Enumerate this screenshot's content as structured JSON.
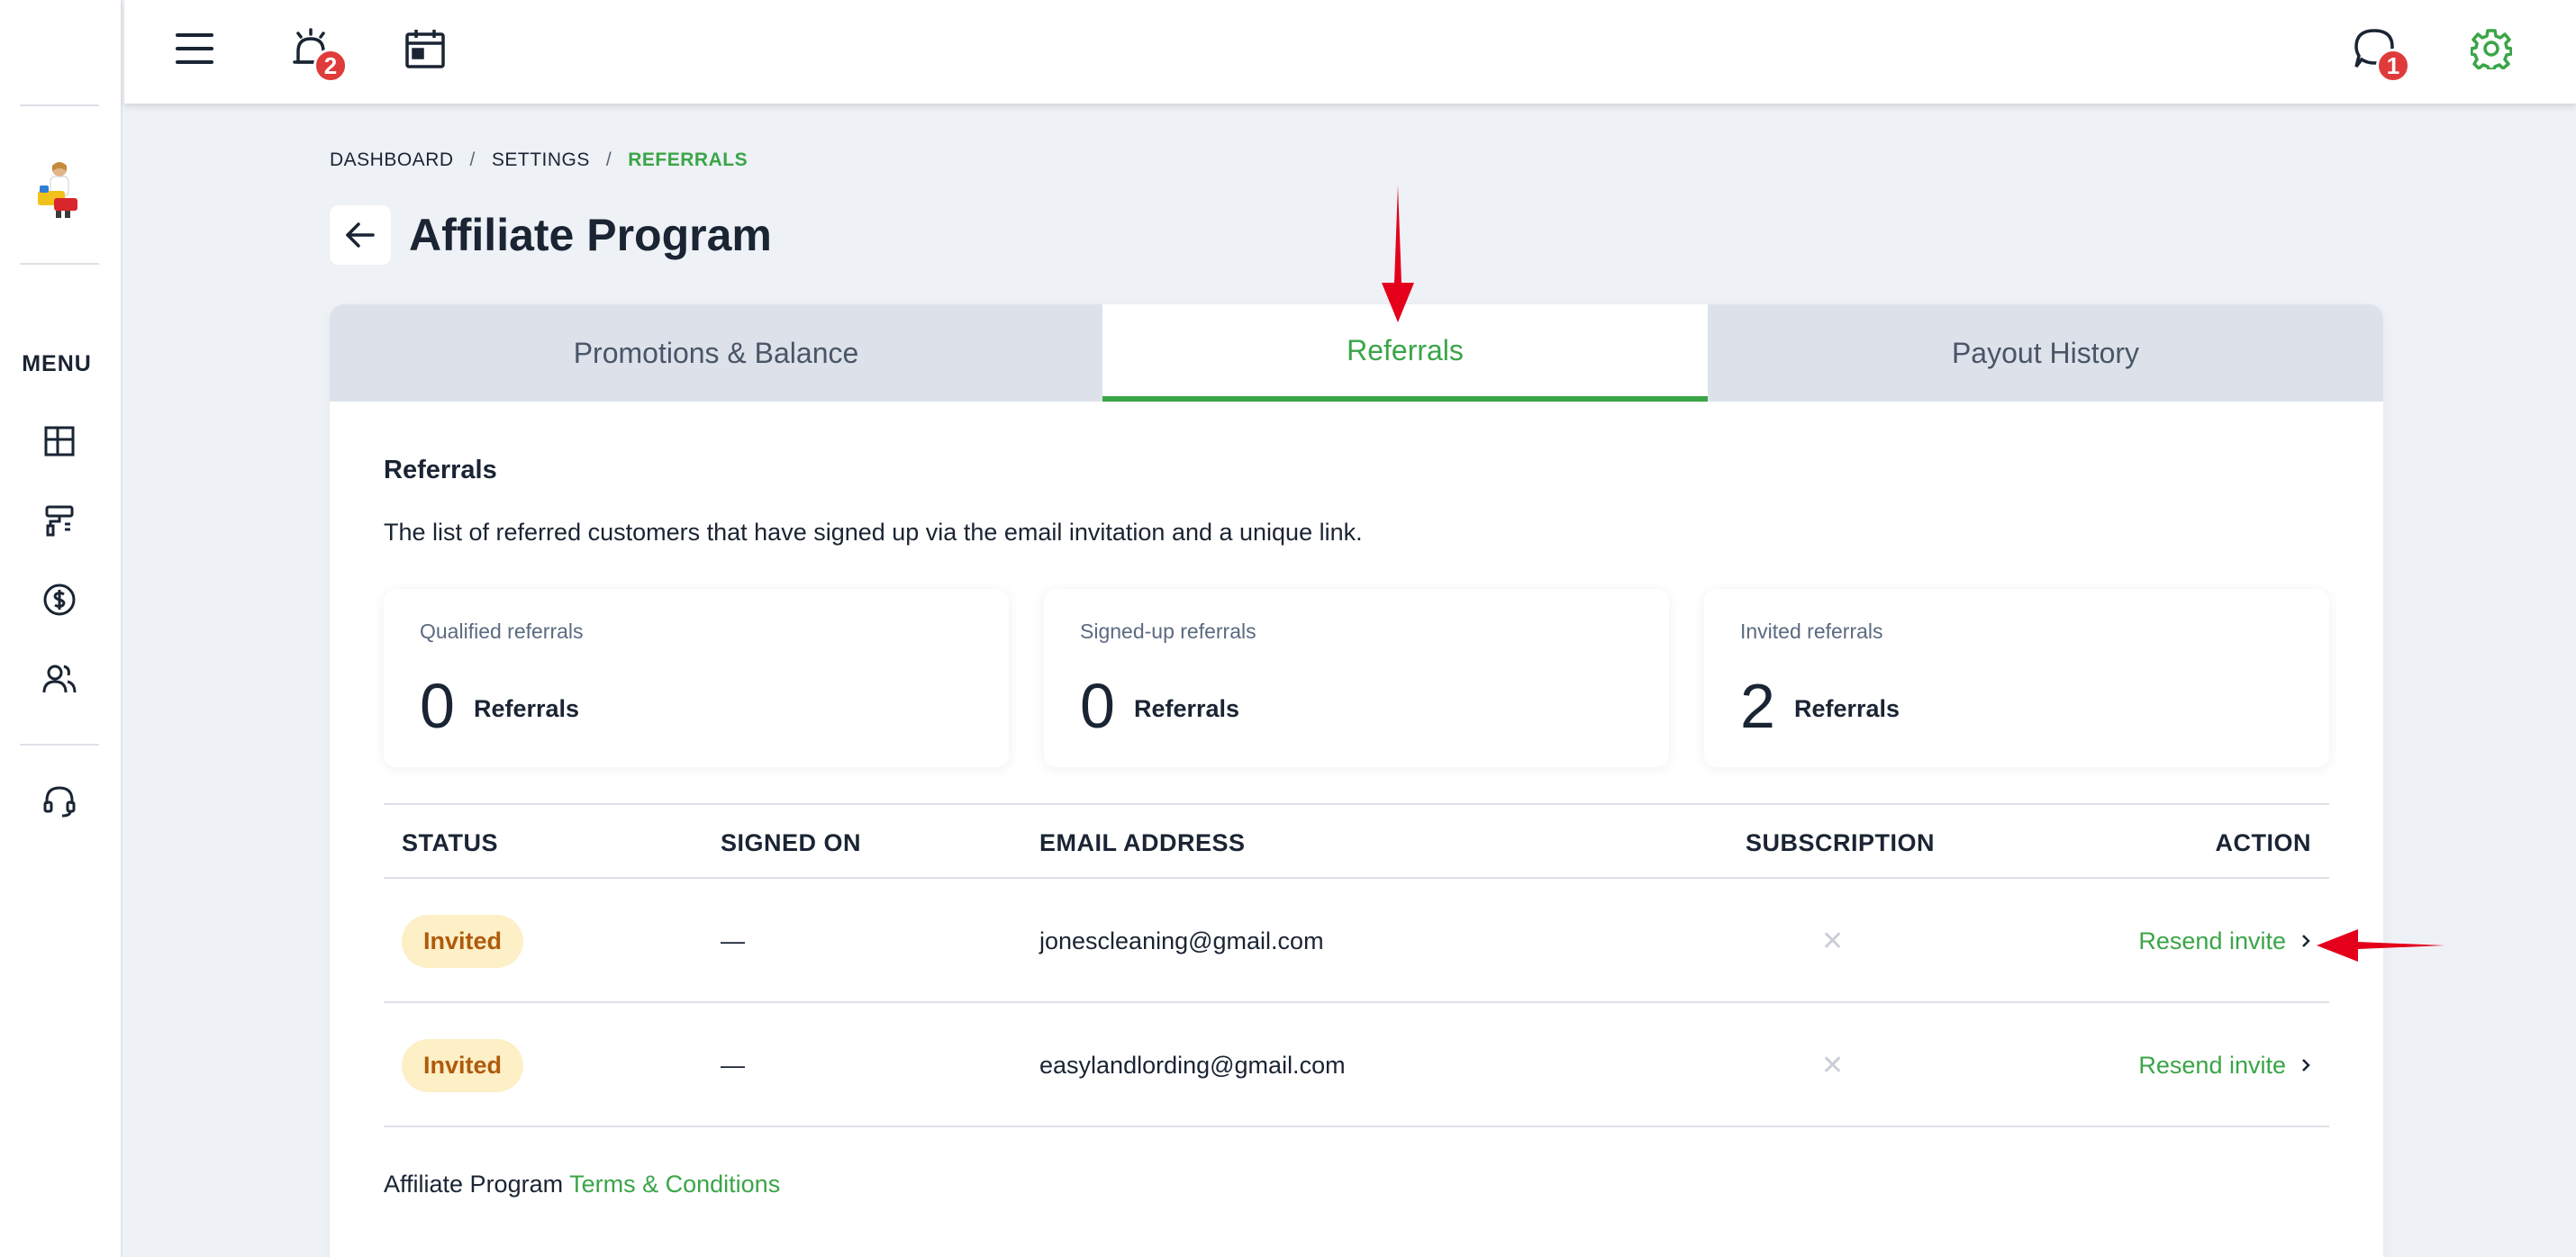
{
  "sidebar": {
    "menu_label": "MENU",
    "icons": [
      "dashboard-icon",
      "paint-roller-icon",
      "dollar-icon",
      "users-icon",
      "headset-icon"
    ]
  },
  "topbar": {
    "alarm_badge": "2",
    "chat_badge": "1",
    "colors": {
      "accent": "#3aa547",
      "badge": "#e03b3b"
    }
  },
  "breadcrumb": {
    "items": [
      "DASHBOARD",
      "SETTINGS",
      "REFERRALS"
    ],
    "separator": "/"
  },
  "page": {
    "title": "Affiliate Program"
  },
  "tabs": [
    {
      "label": "Promotions & Balance",
      "active": false
    },
    {
      "label": "Referrals",
      "active": true
    },
    {
      "label": "Payout History",
      "active": false
    }
  ],
  "section": {
    "title": "Referrals",
    "description": "The list of referred customers that have signed up via the email invitation and a unique link."
  },
  "stats": [
    {
      "label": "Qualified referrals",
      "value": "0",
      "unit": "Referrals"
    },
    {
      "label": "Signed-up referrals",
      "value": "0",
      "unit": "Referrals"
    },
    {
      "label": "Invited referrals",
      "value": "2",
      "unit": "Referrals"
    }
  ],
  "table": {
    "headers": {
      "status": "STATUS",
      "signed_on": "SIGNED ON",
      "email": "EMAIL ADDRESS",
      "subscription": "SUBSCRIPTION",
      "action": "ACTION"
    },
    "rows": [
      {
        "status": "Invited",
        "signed_on": "—",
        "email": "jonescleaning@gmail.com",
        "subscription": "✕",
        "action": "Resend invite"
      },
      {
        "status": "Invited",
        "signed_on": "—",
        "email": "easylandlording@gmail.com",
        "subscription": "✕",
        "action": "Resend invite"
      }
    ]
  },
  "footer": {
    "text": "Affiliate Program",
    "link": "Terms & Conditions"
  }
}
